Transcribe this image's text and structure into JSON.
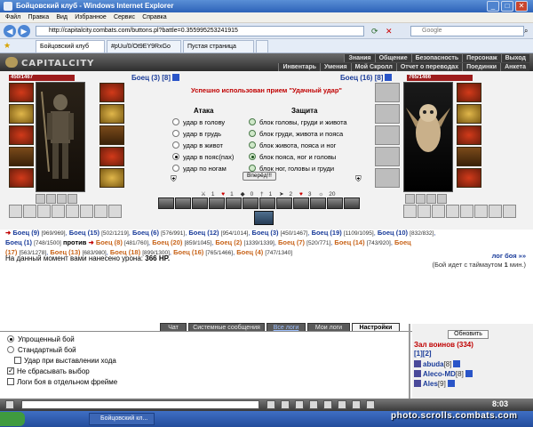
{
  "window": {
    "title": "Бойцовский клуб - Windows Internet Explorer",
    "min": "_",
    "max": "□",
    "close": "✕"
  },
  "menu": [
    "Файл",
    "Правка",
    "Вид",
    "Избранное",
    "Сервис",
    "Справка"
  ],
  "address": {
    "url": "http://capitalcity.combats.com/buttons.pl?battle=0.355995253241915",
    "search_placeholder": "Google"
  },
  "tabs": [
    "Бойцовский клуб",
    "#pUu/0/Ot9EY9RxGo",
    "Пустая страница"
  ],
  "game": {
    "logo": "CAPITALCITY",
    "nav_row1": [
      "Знания",
      "Общение",
      "Безопасность",
      "Персонаж",
      "Выход"
    ],
    "nav_row2": [
      "Инвентарь",
      "Умения",
      "Мой Скролл",
      "Отчет о переводах",
      "Поединки",
      "Анкета"
    ]
  },
  "player": {
    "name": "Боец (3)",
    "level_tag": "[8]",
    "hp": "450/1467"
  },
  "enemy": {
    "name": "Боец (16)",
    "level_tag": "[8]",
    "hp": "765/1466"
  },
  "battle": {
    "success_msg": "Успешно использован прием \"Удачный удар\"",
    "attack_head": "Атака",
    "defense_head": "Защита",
    "attack": [
      "удар в голову",
      "удар в грудь",
      "удар в живот",
      "удар в пояс(пах)",
      "удар по ногам"
    ],
    "attack_selected": 3,
    "defense": [
      "блок головы, груди и живота",
      "блок груди, живота и пояса",
      "блок живота, пояса и ног",
      "блок пояса, ног и головы",
      "блок ног, головы и груди"
    ],
    "defense_selected": 3,
    "forward": "Вперёд!!!",
    "stats": [
      "1",
      "1",
      "0",
      "1",
      "2",
      "3",
      "20"
    ]
  },
  "teams": {
    "line1": [
      {
        "n": "Боец (9)",
        "hp": "[969/969]"
      },
      {
        "n": "Боец (15)",
        "hp": "[502/1219]"
      },
      {
        "n": "Боец (6)",
        "hp": "[576/991]"
      },
      {
        "n": "Боец (12)",
        "hp": "[954/1014]"
      },
      {
        "n": "Боец (3)",
        "hp": "[450/1467]"
      },
      {
        "n": "Боец (19)",
        "hp": "[1109/1095]"
      },
      {
        "n": "Боец (10)",
        "hp": "[832/832]"
      }
    ],
    "line2_left": [
      {
        "n": "Боец (1)",
        "hp": "[748/1500]"
      }
    ],
    "vs": "против",
    "line2_right": [
      {
        "n": "Боец (8)",
        "hp": "[481/760]"
      },
      {
        "n": "Боец (20)",
        "hp": "[859/1045]"
      },
      {
        "n": "Боец (2)",
        "hp": "[1339/1339]"
      },
      {
        "n": "Боец (7)",
        "hp": "[520/771]"
      },
      {
        "n": "Боец (14)",
        "hp": "[743/920]"
      },
      {
        "n": "Боец"
      }
    ],
    "line3": [
      {
        "n": "(17)",
        "hp": "[563/1278]"
      },
      {
        "n": "Боец (13)",
        "hp": "[683/980]"
      },
      {
        "n": "Боец (18)",
        "hp": "[899/1300]"
      },
      {
        "n": "Боец (16)",
        "hp": "[765/1466]"
      },
      {
        "n": "Боец (4)",
        "hp": "[747/1340]"
      }
    ],
    "log_link": "лог боя »»",
    "damage_label": "На данный момент вами нанесено урона:",
    "damage_value": "366 HP.",
    "timeout_pre": "(Бой идет с таймаутом",
    "timeout_num": "1",
    "timeout_post": "мин.)"
  },
  "chat": {
    "tabs": [
      "Чат",
      "Системные сообщения",
      "Все логи",
      "Мои логи",
      "Настройки"
    ],
    "options": [
      {
        "label": "Упрощенный бой",
        "type": "radio",
        "on": true
      },
      {
        "label": "Стандартный бой",
        "type": "radio",
        "on": false
      },
      {
        "label": "Удар при выставлении хода",
        "type": "check",
        "on": false
      },
      {
        "label": "Не сбрасывать выбор",
        "type": "check",
        "on": true
      },
      {
        "label": "Логи боя в отдельном фрейме",
        "type": "check",
        "on": false
      }
    ]
  },
  "hall": {
    "refresh": "Обновить",
    "title": "Зал воинов (334)",
    "pages": "[1][2]",
    "members": [
      {
        "name": "abuda",
        "lvl": "[8]"
      },
      {
        "name": "Aleco-MD",
        "lvl": "[8]"
      },
      {
        "name": "Ales",
        "lvl": "[9]"
      }
    ]
  },
  "chatbar": {
    "clock": "8:03"
  },
  "taskbar": {
    "item": "Бойцовский кл..."
  },
  "watermark": "photo.scrolls.combats.com"
}
